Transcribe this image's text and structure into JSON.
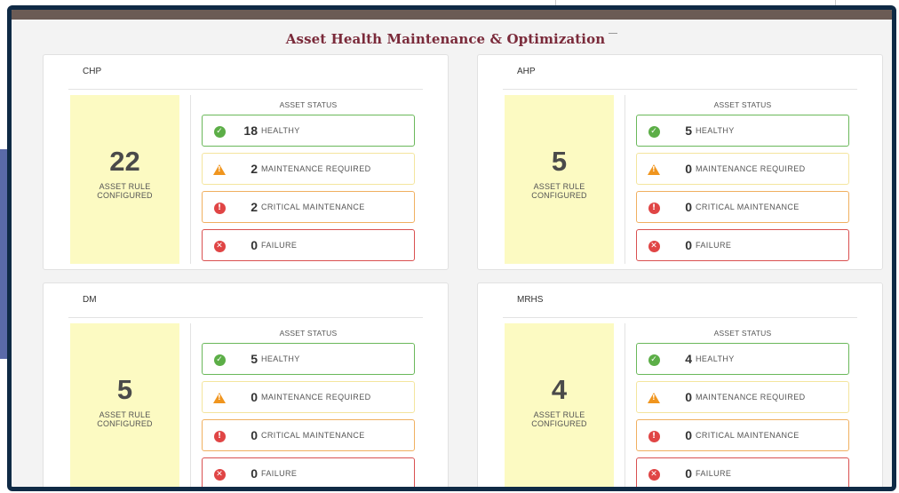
{
  "page": {
    "title": "Asset Health Maintenance & Optimization"
  },
  "colors": {
    "title": "#7a2a3a",
    "healthy": "#5cae47",
    "maintenance": "#f0951e",
    "critical": "#e04545",
    "failure": "#e04545",
    "rule_bg": "#fcfac2",
    "frame": "#0f2a45"
  },
  "icons": {
    "healthy": "check-circle-icon",
    "maintenance": "warning-triangle-icon",
    "critical": "exclamation-circle-icon",
    "failure": "x-circle-icon"
  },
  "cards": [
    {
      "name": "CHP",
      "rule_count": "22",
      "rule_label": "ASSET RULE CONFIGURED",
      "status_heading": "ASSET STATUS",
      "statuses": [
        {
          "count": "18",
          "label": "HEALTHY"
        },
        {
          "count": "2",
          "label": "MAINTENANCE REQUIRED"
        },
        {
          "count": "2",
          "label": "CRITICAL MAINTENANCE"
        },
        {
          "count": "0",
          "label": "FAILURE"
        }
      ]
    },
    {
      "name": "AHP",
      "rule_count": "5",
      "rule_label": "ASSET RULE CONFIGURED",
      "status_heading": "ASSET STATUS",
      "statuses": [
        {
          "count": "5",
          "label": "HEALTHY"
        },
        {
          "count": "0",
          "label": "MAINTENANCE REQUIRED"
        },
        {
          "count": "0",
          "label": "CRITICAL MAINTENANCE"
        },
        {
          "count": "0",
          "label": "FAILURE"
        }
      ]
    },
    {
      "name": "DM",
      "rule_count": "5",
      "rule_label": "ASSET RULE CONFIGURED",
      "status_heading": "ASSET STATUS",
      "statuses": [
        {
          "count": "5",
          "label": "HEALTHY"
        },
        {
          "count": "0",
          "label": "MAINTENANCE REQUIRED"
        },
        {
          "count": "0",
          "label": "CRITICAL MAINTENANCE"
        },
        {
          "count": "0",
          "label": "FAILURE"
        }
      ]
    },
    {
      "name": "MRHS",
      "rule_count": "4",
      "rule_label": "ASSET RULE CONFIGURED",
      "status_heading": "ASSET STATUS",
      "statuses": [
        {
          "count": "4",
          "label": "HEALTHY"
        },
        {
          "count": "0",
          "label": "MAINTENANCE REQUIRED"
        },
        {
          "count": "0",
          "label": "CRITICAL MAINTENANCE"
        },
        {
          "count": "0",
          "label": "FAILURE"
        }
      ]
    }
  ]
}
